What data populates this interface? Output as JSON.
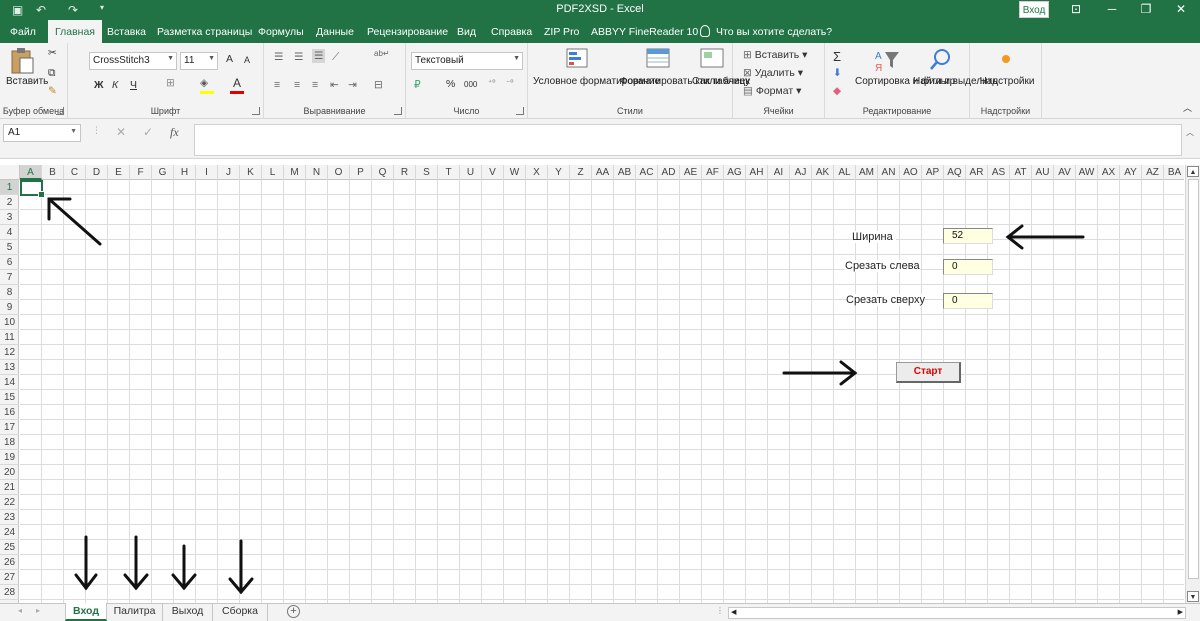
{
  "titlebar": {
    "title": "PDF2XSD  -  Excel",
    "sign_in": "Вход",
    "icons": [
      "save-icon",
      "undo-icon",
      "redo-icon",
      "customize-qat-icon",
      "ribbon-display-icon",
      "minimize-icon",
      "restore-icon",
      "close-icon"
    ]
  },
  "menu": {
    "tabs": [
      "Файл",
      "Главная",
      "Вставка",
      "Разметка страницы",
      "Формулы",
      "Данные",
      "Рецензирование",
      "Вид",
      "Справка",
      "ZIP Pro",
      "ABBYY FineReader 10"
    ],
    "active": "Главная",
    "tell_me": "Что вы хотите сделать?"
  },
  "ribbon": {
    "clipboard": {
      "paste": "Вставить",
      "label": "Буфер обмена"
    },
    "font": {
      "name": "CrossStitch3",
      "size": "11",
      "bold": "Ж",
      "italic": "К",
      "underline": "Ч",
      "grow": "A",
      "shrink": "A",
      "font_color_letter": "A",
      "label": "Шрифт"
    },
    "alignment": {
      "label": "Выравнивание"
    },
    "number": {
      "format": "Текстовый",
      "percent": "%",
      "thousands": "000",
      "label": "Число"
    },
    "styles": {
      "conditional": "Условное форматирование",
      "as_table": "Форматировать как таблицу",
      "cell_styles": "Стили ячеек",
      "label": "Стили"
    },
    "cells": {
      "insert": "Вставить",
      "delete": "Удалить",
      "format": "Формат",
      "label": "Ячейки"
    },
    "editing": {
      "sum": "Σ",
      "sort": "Сортировка и фильтр",
      "find": "Найти и выделить",
      "label": "Редактирование"
    },
    "addins": {
      "addins": "Надстройки",
      "label": "Надстройки"
    }
  },
  "formula_bar": {
    "name_box": "A1",
    "fx": "fx",
    "content": ""
  },
  "sheet": {
    "columns": [
      "A",
      "B",
      "C",
      "D",
      "E",
      "F",
      "G",
      "H",
      "I",
      "J",
      "K",
      "L",
      "M",
      "N",
      "O",
      "P",
      "Q",
      "R",
      "S",
      "T",
      "U",
      "V",
      "W",
      "X",
      "Y",
      "Z",
      "AA",
      "AB",
      "AC",
      "AD",
      "AE",
      "AF",
      "AG",
      "AH",
      "AI",
      "AJ",
      "AK",
      "AL",
      "AM",
      "AN",
      "AO",
      "AP",
      "AQ",
      "AR",
      "AS",
      "AT",
      "AU",
      "AV",
      "AW",
      "AX",
      "AY",
      "AZ",
      "BA"
    ],
    "rows": [
      "1",
      "2",
      "3",
      "4",
      "5",
      "6",
      "7",
      "8",
      "9",
      "10",
      "11",
      "12",
      "13",
      "14",
      "15",
      "16",
      "17",
      "18",
      "19",
      "20",
      "21",
      "22",
      "23",
      "24",
      "25",
      "26",
      "27",
      "28"
    ],
    "active_cell": "A1",
    "form": {
      "width_label": "Ширина",
      "width_value": "52",
      "left_label": "Срезать слева",
      "left_value": "0",
      "top_label": "Срезать сверху",
      "top_value": "0",
      "start_button": "Старт"
    }
  },
  "sheet_tabs": {
    "tabs": [
      "Вход",
      "Палитра",
      "Выход",
      "Сборка"
    ],
    "active": "Вход",
    "add": "+"
  }
}
